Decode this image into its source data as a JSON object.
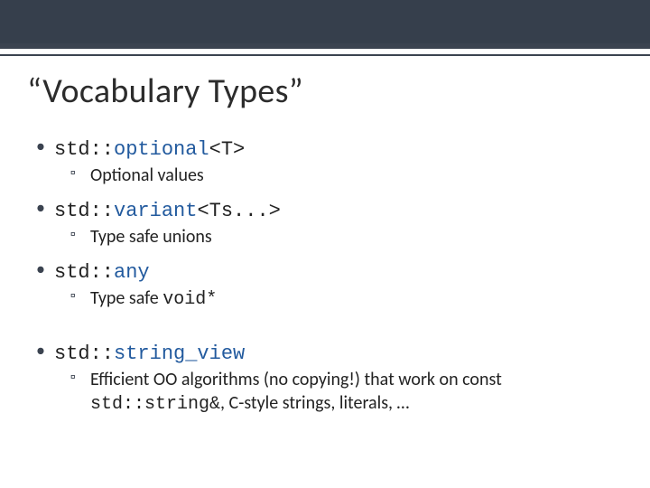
{
  "title": "“Vocabulary Types”",
  "items": [
    {
      "code_prefix": "std::",
      "code_name": "optional",
      "code_suffix": "<T>",
      "sub": {
        "text": "Optional values"
      }
    },
    {
      "code_prefix": "std::",
      "code_name": "variant",
      "code_suffix": "<Ts...>",
      "sub": {
        "text": "Type safe unions"
      }
    },
    {
      "code_prefix": "std::",
      "code_name": "any",
      "code_suffix": "",
      "sub": {
        "before": "Type safe ",
        "code": "void*",
        "after": ""
      }
    },
    {
      "gap": true,
      "code_prefix": "std::",
      "code_name": "string_view",
      "code_suffix": "",
      "sub": {
        "before": "Efficient OO algorithms (no copying!) that work on const ",
        "code": "std::string&",
        "after": ", C-style strings, literals, …"
      }
    }
  ]
}
